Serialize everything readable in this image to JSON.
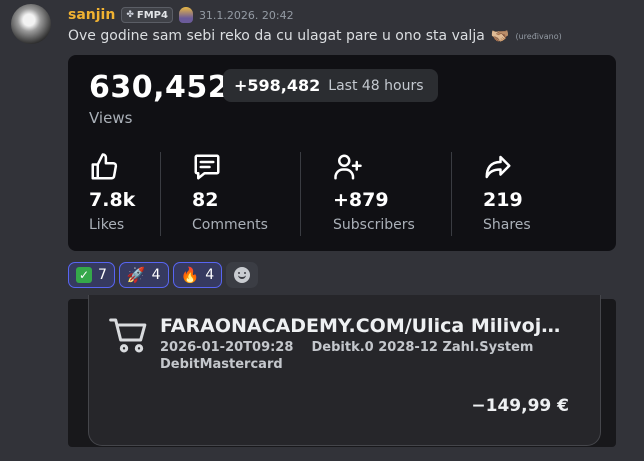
{
  "message": {
    "username": "sanjin",
    "tag": {
      "icon": "clover-icon",
      "label": "FMP4"
    },
    "role_icon": "shield-role-icon",
    "timestamp": "31.1.2026. 20:42",
    "text": "Ove godine sam sebi reko da cu ulagat pare u ono sta valja",
    "text_emoji": "🫱🏼‍🫲🏽",
    "edited_label": "(uređivano)"
  },
  "stats_card": {
    "views": "630,452",
    "views_label": "Views",
    "delta": "+598,482",
    "delta_label": "Last 48 hours",
    "metrics": [
      {
        "icon": "thumbs-up-icon",
        "value": "7.8k",
        "label": "Likes"
      },
      {
        "icon": "comment-icon",
        "value": "82",
        "label": "Comments"
      },
      {
        "icon": "add-user-icon",
        "value": "+879",
        "label": "Subscribers"
      },
      {
        "icon": "share-icon",
        "value": "219",
        "label": "Shares"
      }
    ]
  },
  "reactions": [
    {
      "emoji": "✓",
      "icon": "check-mark-emoji",
      "count": "7"
    },
    {
      "emoji": "🚀",
      "icon": "rocket-emoji",
      "count": "4"
    },
    {
      "emoji": "🔥",
      "icon": "fire-emoji",
      "count": "4"
    }
  ],
  "receipt": {
    "icon": "shopping-cart-icon",
    "merchant": "FARAONACADEMY.COM/Ulica Milivoja Ma...",
    "line1": "2026-01-20T09:28    Debitk.0 2028-12 Zahl.System",
    "line2": "DebitMastercard",
    "amount": "−149,99 €"
  },
  "colors": {
    "background": "#323339",
    "username": "#f0b232",
    "reaction_border": "#5865f2",
    "card": "#101014"
  }
}
